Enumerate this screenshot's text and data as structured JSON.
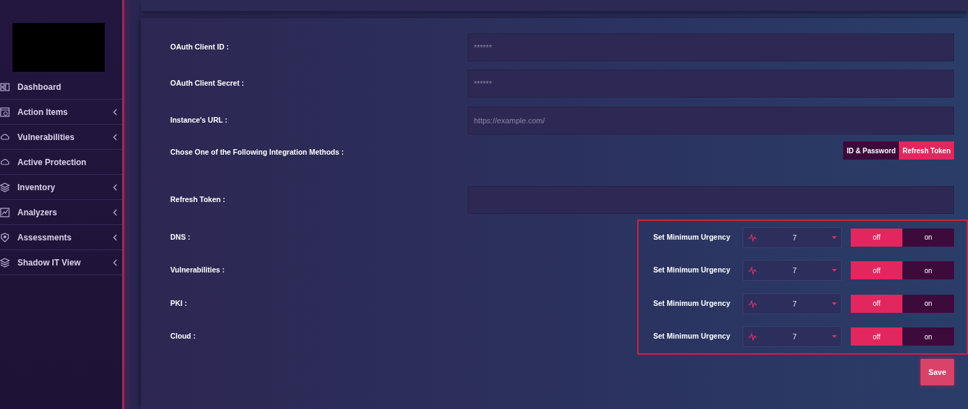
{
  "sidebar": {
    "items": [
      {
        "label": "Dashboard",
        "has_submenu": false
      },
      {
        "label": "Action Items",
        "has_submenu": true
      },
      {
        "label": "Vulnerabilities",
        "has_submenu": true
      },
      {
        "label": "Active Protection",
        "has_submenu": false
      },
      {
        "label": "Inventory",
        "has_submenu": true
      },
      {
        "label": "Analyzers",
        "has_submenu": true
      },
      {
        "label": "Assessments",
        "has_submenu": true
      },
      {
        "label": "Shadow IT View",
        "has_submenu": true
      }
    ]
  },
  "form": {
    "fields": [
      {
        "label": "OAuth Client ID :",
        "placeholder": "******"
      },
      {
        "label": "OAuth Client Secret :",
        "placeholder": "******"
      },
      {
        "label": "Instance's URL :",
        "placeholder": "https://example.com/"
      }
    ],
    "integration": {
      "label": "Chose One of the Following Integration Methods :",
      "options": [
        {
          "label": "ID & Password",
          "selected": false
        },
        {
          "label": "Refresh Token",
          "selected": true
        }
      ]
    },
    "refresh_token": {
      "label": "Refresh Token :"
    },
    "urgency_rows": [
      {
        "label": "DNS :",
        "setting_label": "Set Minimum Urgency",
        "value": "7",
        "toggle": [
          {
            "label": "off",
            "selected": true
          },
          {
            "label": "on",
            "selected": false
          }
        ]
      },
      {
        "label": "Vulnerabilities :",
        "setting_label": "Set Minimum Urgency",
        "value": "7",
        "toggle": [
          {
            "label": "off",
            "selected": true
          },
          {
            "label": "on",
            "selected": false
          }
        ]
      },
      {
        "label": "PKI :",
        "setting_label": "Set Minimum Urgency",
        "value": "7",
        "toggle": [
          {
            "label": "off",
            "selected": true
          },
          {
            "label": "on",
            "selected": false
          }
        ]
      },
      {
        "label": "Cloud :",
        "setting_label": "Set Minimum Urgency",
        "value": "7",
        "toggle": [
          {
            "label": "off",
            "selected": true
          },
          {
            "label": "on",
            "selected": false
          }
        ]
      }
    ],
    "save_button": "Save"
  }
}
